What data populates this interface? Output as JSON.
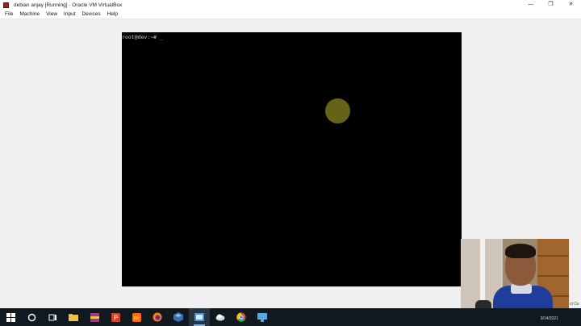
{
  "window": {
    "title": "debian anjay [Running] - Oracle VM VirtualBox",
    "controls": {
      "minimize": "—",
      "restore": "❐",
      "close": "✕"
    }
  },
  "menu": [
    "File",
    "Machine",
    "View",
    "Input",
    "Devices",
    "Help"
  ],
  "console": {
    "prompt": "root@dev:~# _"
  },
  "side_text": "ct Ce",
  "clock": "9/14/2021",
  "colors": {
    "app_icon": "#9d1d2a",
    "vm_background": "#000000",
    "cursor_highlight": "#66621a",
    "taskbar": "#101820"
  },
  "taskbar": [
    {
      "name": "start-button",
      "icon": "windows-logo-icon",
      "color": "#ffffff"
    },
    {
      "name": "search-button",
      "icon": "search-circle-icon",
      "color": "#ffffff"
    },
    {
      "name": "task-view-button",
      "icon": "task-view-icon",
      "color": "#ffffff"
    },
    {
      "name": "file-explorer-button",
      "icon": "folder-icon",
      "color": "#f2c04a"
    },
    {
      "name": "winrar-button",
      "icon": "winrar-icon",
      "color": "#9b3b8a"
    },
    {
      "name": "powerpoint-button",
      "icon": "powerpoint-icon",
      "color": "#d04423"
    },
    {
      "name": "mi-button",
      "icon": "mi-icon",
      "color": "#ff6a00"
    },
    {
      "name": "firefox-button",
      "icon": "firefox-icon",
      "color": "#ff7a1a"
    },
    {
      "name": "virtualbox-button",
      "icon": "virtualbox-icon",
      "color": "#3b6fb6"
    },
    {
      "name": "virtualbox-running-button",
      "icon": "virtualbox-vm-icon",
      "color": "#4a90d9"
    },
    {
      "name": "cloud-app-button",
      "icon": "cloud-icon",
      "color": "#d8d8d8"
    },
    {
      "name": "chrome-button",
      "icon": "chrome-icon",
      "color": "#e04a3c"
    },
    {
      "name": "remote-desktop-button",
      "icon": "remote-desktop-icon",
      "color": "#5aa7e0"
    }
  ]
}
